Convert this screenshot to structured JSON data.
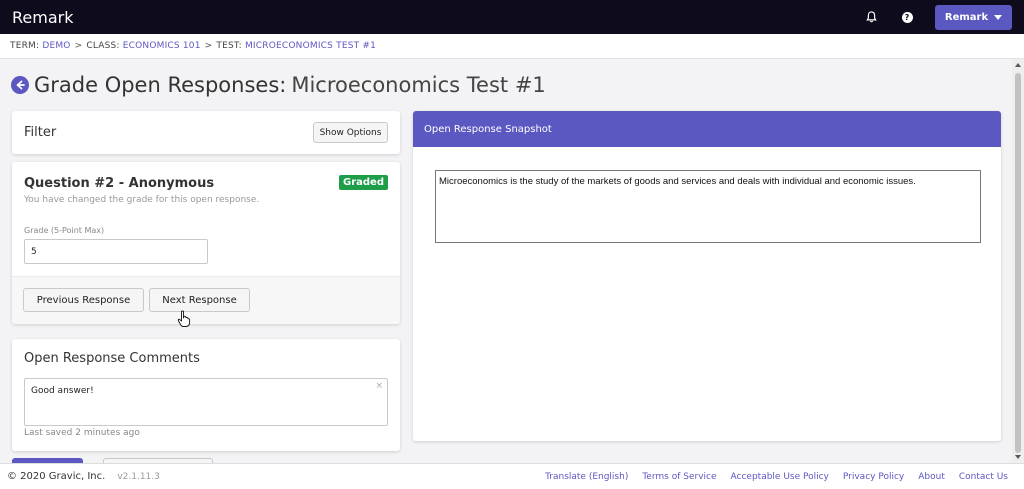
{
  "app": {
    "title": "Remark",
    "account_label": "Remark"
  },
  "breadcrumb": {
    "term_label": "TERM:",
    "term_value": "DEMO",
    "class_label": "CLASS:",
    "class_value": "ECONOMICS 101",
    "test_label": "TEST:",
    "test_value": "MICROECONOMICS TEST #1",
    "separator": ">"
  },
  "page": {
    "title_prefix": "Grade Open Responses:",
    "title_main": "Microeconomics Test #1"
  },
  "filter": {
    "title": "Filter",
    "show_options_label": "Show Options"
  },
  "question": {
    "title": "Question #2 - Anonymous",
    "status_badge": "Graded",
    "note": "You have changed the grade for this open response.",
    "grade_label": "Grade (5-Point Max)",
    "grade_value": "5",
    "prev_label": "Previous Response",
    "next_label": "Next Response"
  },
  "comments": {
    "title": "Open Response Comments",
    "value": "Good answer!",
    "clear_icon": "×",
    "saved_note": "Last saved 2 minutes ago"
  },
  "snapshot": {
    "header": "Open Response Snapshot",
    "text": "Microeconomics is the study of the markets of goods and services and deals with individual and economic issues."
  },
  "footer": {
    "copyright": "© 2020 Gravic, Inc.",
    "version": "v2.1.11.3",
    "links": [
      "Translate (English)",
      "Terms of Service",
      "Acceptable Use Policy",
      "Privacy Policy",
      "About",
      "Contact Us"
    ]
  },
  "colors": {
    "accent": "#5b58c2",
    "nav_bg": "#0e0b1c",
    "badge_green": "#1f9e4a"
  },
  "icons": {
    "notifications": "bell-icon",
    "help": "help-icon",
    "back": "back-arrow-icon",
    "dropdown": "caret-down-icon"
  }
}
